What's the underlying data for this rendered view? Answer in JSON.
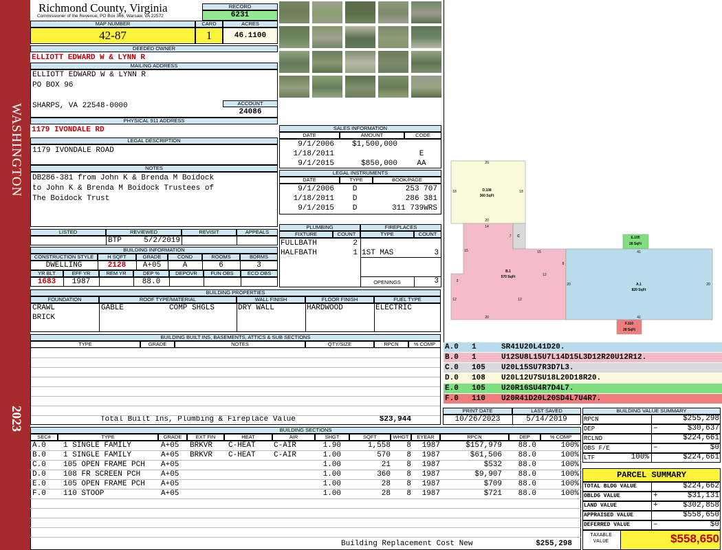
{
  "sidebar": {
    "city": "WASHINGTON",
    "year": "2023"
  },
  "header": {
    "county": "Richmond County, Virginia",
    "commissioner": "Commissioner of the Revenue, PO Box 366, Warsaw, VA 22572",
    "record_label": "RECORD",
    "record": "6231",
    "map_label": "MAP NUMBER",
    "map": "42-87",
    "card_label": "CARD",
    "card": "1",
    "acres_label": "ACRES",
    "acres": "46.1100"
  },
  "owner": {
    "deeded_label": "DEEDED OWNER",
    "deeded": "ELLIOTT EDWARD W & LYNN R",
    "mailing_label": "MAILING ADDRESS",
    "mail1": "ELLIOTT EDWARD W & LYNN R",
    "mail2": "PO BOX 96",
    "mail3": "SHARPS, VA 22548-0000",
    "account_label": "ACCOUNT",
    "account": "24086",
    "address_label": "PHYSICAL 911 ADDRESS",
    "address": "1179 IVONDALE RD"
  },
  "legal": {
    "label": "LEGAL DESCRIPTION",
    "text": "1179 IVONDALE ROAD"
  },
  "notes": {
    "label": "NOTES",
    "l1": "DB286-381 from John K & Brenda M Boidock",
    "l2": "to John K & Brenda M Boidock Trustees of",
    "l3": "The Boidock Trust"
  },
  "review": {
    "listed": "LISTED",
    "reviewed": "REVIEWED",
    "revisit": "REVISIT",
    "appeals": "APPEALS",
    "by": "BTP",
    "date": "5/2/2019"
  },
  "bldg": {
    "label": "BUILDING INFORMATION",
    "h": [
      "CONSTRUCTION STYLE",
      "H SQFT",
      "GRADE",
      "COND",
      "ROOMS",
      "BDRMS"
    ],
    "v": [
      "DWELLING",
      "2128",
      "A+05",
      "A",
      "6",
      "3"
    ],
    "h2": [
      "YR BLT",
      "EFF YR",
      "REM YR",
      "DEP %",
      "DEPOVR",
      "FUN OBS",
      "ECO OBS"
    ],
    "v2": [
      "1683",
      "1987",
      "",
      "88.0",
      "",
      "",
      ""
    ]
  },
  "props": {
    "label": "BUILDING PROPERTIES",
    "h": [
      "FOUNDATION",
      "ROOF TYPE/MATERIAL",
      "WALL FINISH",
      "FLOOR FINISH",
      "FUEL TYPE"
    ],
    "found1": "CRAWL",
    "found2": "BRICK",
    "roof": "GABLE",
    "roof2": "COMP SHGLS",
    "wall": "DRY WALL",
    "floor": "HARDWOOD",
    "fuel": "ELECTRIC"
  },
  "builtins": {
    "label": "BUILDING BUILT INS, BASEMENTS, ATTICS & SUB SECTIONS",
    "h": [
      "TYPE",
      "GRADE",
      "NOTES",
      "QTY/SIZE",
      "RPCN",
      "% COMP"
    ],
    "total_label": "Total Built Ins, Plumbing & Fireplace Value",
    "total": "$23,944"
  },
  "sales": {
    "label": "SALES INFORMATION",
    "h": [
      "DATE",
      "AMOUNT",
      "CODE"
    ],
    "rows": [
      [
        "9/1/2006",
        "$1,500,000",
        ""
      ],
      [
        "1/18/2011",
        "",
        "E"
      ],
      [
        "9/1/2015",
        "$850,000",
        "AA"
      ]
    ]
  },
  "instr": {
    "label": "LEGAL INSTRUMENTS",
    "h": [
      "DATE",
      "TYPE",
      "BOOK/PAGE"
    ],
    "rows": [
      [
        "9/1/2006",
        "D",
        "253 707"
      ],
      [
        "1/18/2011",
        "D",
        "286 381"
      ],
      [
        "9/1/2015",
        "D",
        "311 739WRS"
      ]
    ]
  },
  "plumb": {
    "label": "PLUMBING",
    "h": [
      "FIXTURE",
      "COUNT"
    ],
    "rows": [
      [
        "FULLBATH",
        "2"
      ],
      [
        "HALFBATH",
        "1"
      ]
    ]
  },
  "fire": {
    "label": "FIREPLACES",
    "h": [
      "TYPE",
      "COUNT"
    ],
    "rows": [
      [
        "1ST MAS",
        "3"
      ]
    ],
    "openings_label": "OPENINGS",
    "openings": "3"
  },
  "sketch": {
    "labels": {
      "d": "D.108",
      "d_area": "360 SqFt",
      "e": "E.105",
      "e_area": "28 SqFt",
      "b": "B.1",
      "b_area": "570 SqFt",
      "c": "C",
      "a": "A.1",
      "a_area": "820 SqFt",
      "f": "F.110",
      "f_area": "28 SqFt"
    },
    "dims": {
      "d_top": "20",
      "d_left": "18",
      "d_right": "18",
      "d_bot": "20",
      "b_top": "14",
      "b_7": "7",
      "b_15l": "15",
      "b_15r": "15",
      "b_8": "8",
      "b_12r": "12",
      "b_3": "3",
      "b_12l": "12",
      "b_12b": "12",
      "b_20": "20",
      "a_41t": "41",
      "a_20l": "20",
      "a_20r": "20",
      "a_41b": "41"
    }
  },
  "areas": [
    {
      "code": "A.0",
      "n": "1",
      "desc": "SR41U20L41D20.",
      "color": "#b9dcec"
    },
    {
      "code": "B.0",
      "n": "1",
      "desc": "U12SU8L15U7L14D15L3D12R20U12R12.",
      "color": "#f4bcc9"
    },
    {
      "code": "C.0",
      "n": "105",
      "desc": "U20L15SU7R3D7L3.",
      "color": "#d9d9d9"
    },
    {
      "code": "D.0",
      "n": "108",
      "desc": "U20L12U7SU18L20D18R20.",
      "color": "#fafadb"
    },
    {
      "code": "E.0",
      "n": "105",
      "desc": "U20R16SU4R7D4L7.",
      "color": "#7ee07e"
    },
    {
      "code": "F.0",
      "n": "110",
      "desc": "U20R41D20L20SD4L7U4R7.",
      "color": "#ee7e7e"
    }
  ],
  "print": {
    "print_label": "PRINT DATE",
    "saved_label": "LAST SAVED",
    "print": "10/26/2023",
    "saved": "5/14/2019"
  },
  "sections": {
    "label": "BUILDING SECTIONS",
    "h": [
      "SEC#",
      "TYPE",
      "GRADE",
      "EXT FIN",
      "HEAT",
      "AIR",
      "SHGT",
      "SQFT",
      "WHGT",
      "EYEAR",
      "RPCN",
      "DEP",
      "% COMP"
    ],
    "rows": [
      [
        "A.0",
        "1 SINGLE FAMILY",
        "A+05",
        "BRKVR",
        "C-HEAT",
        "C-AIR",
        "1.90",
        "1,558",
        "8",
        "1987",
        "$157,979",
        "88.0",
        "100%"
      ],
      [
        "B.0",
        "1 SINGLE FAMILY",
        "A+05",
        "BRKVR",
        "C-HEAT",
        "C-AIR",
        "1.00",
        "570",
        "8",
        "1987",
        "$61,506",
        "88.0",
        "100%"
      ],
      [
        "C.0",
        "105 OPEN FRAME PCH",
        "A+05",
        "",
        "",
        "",
        "1.00",
        "21",
        "8",
        "1987",
        "$532",
        "88.0",
        "100%"
      ],
      [
        "D.0",
        "108 FR SCREEN PCH",
        "A+05",
        "",
        "",
        "",
        "1.00",
        "360",
        "8",
        "1987",
        "$9,907",
        "88.0",
        "100%"
      ],
      [
        "E.0",
        "105 OPEN FRAME PCH",
        "A+05",
        "",
        "",
        "",
        "1.00",
        "28",
        "8",
        "1987",
        "$709",
        "88.0",
        "100%"
      ],
      [
        "F.0",
        "110 STOOP",
        "A+05",
        "",
        "",
        "",
        "1.00",
        "28",
        "8",
        "1987",
        "$721",
        "88.0",
        "100%"
      ]
    ],
    "total_label": "Building Replacement Cost New",
    "total": "$255,298"
  },
  "bvs": {
    "label": "BUILDING VALUE SUMMARY",
    "rows": [
      [
        "RPCN",
        "",
        "$255,298"
      ],
      [
        "DEP",
        "–",
        "$30,637"
      ],
      [
        "RCLND",
        "",
        "$224,661"
      ],
      [
        "OBS F/E",
        "–",
        "$0"
      ]
    ],
    "ltf": "LTF",
    "ltf_pct": "100%",
    "ltf_val": "$224,661"
  },
  "summary": {
    "title": "PARCEL SUMMARY",
    "rows": [
      [
        "TOTAL BLDG VALUE",
        "",
        "$224,662"
      ],
      [
        "OBLDG VALUE",
        "+",
        "$31,131"
      ],
      [
        "LAND VALUE",
        "+",
        "$302,858"
      ],
      [
        "APPRAISED VALUE",
        "",
        "$558,650"
      ],
      [
        "DEFERRED VALUE",
        "–",
        "$0"
      ]
    ],
    "taxable_label1": "TAXABLE",
    "taxable_label2": "VALUE",
    "taxable": "$558,650"
  }
}
